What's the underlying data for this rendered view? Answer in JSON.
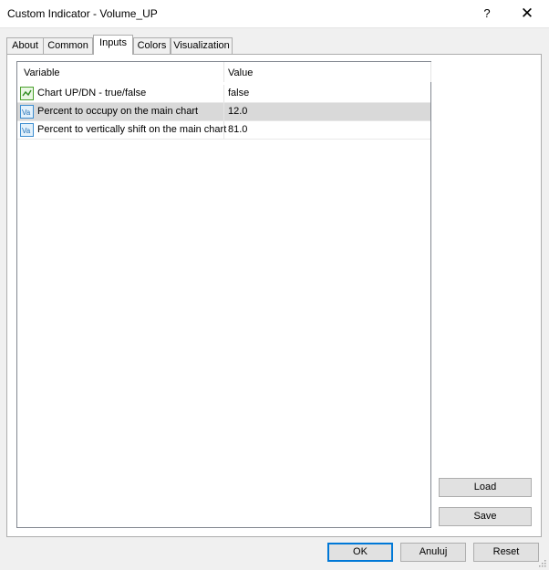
{
  "window": {
    "title": "Custom Indicator - Volume_UP",
    "help_label": "?",
    "close_label": "✕"
  },
  "tabs": [
    {
      "label": "About"
    },
    {
      "label": "Common"
    },
    {
      "label": "Inputs"
    },
    {
      "label": "Colors"
    },
    {
      "label": "Visualization"
    }
  ],
  "active_tab": "Inputs",
  "grid": {
    "headers": {
      "variable": "Variable",
      "value": "Value"
    },
    "rows": [
      {
        "icon": "bool-icon",
        "label": "Chart UP/DN - true/false",
        "value": "false"
      },
      {
        "icon": "double-icon",
        "label": "Percent to occupy on the main chart",
        "value": "12.0"
      },
      {
        "icon": "double-icon",
        "label": "Percent to vertically shift on the main chart",
        "value": "81.0"
      }
    ],
    "selected_row": 1
  },
  "side_buttons": {
    "load": "Load",
    "save": "Save"
  },
  "footer_buttons": {
    "ok": "OK",
    "cancel": "Anuluj",
    "reset": "Reset"
  },
  "colors": {
    "focus_border": "#0078d7",
    "selected_row": "#d9d9d9",
    "dialog_bg": "#f0f0f0"
  }
}
